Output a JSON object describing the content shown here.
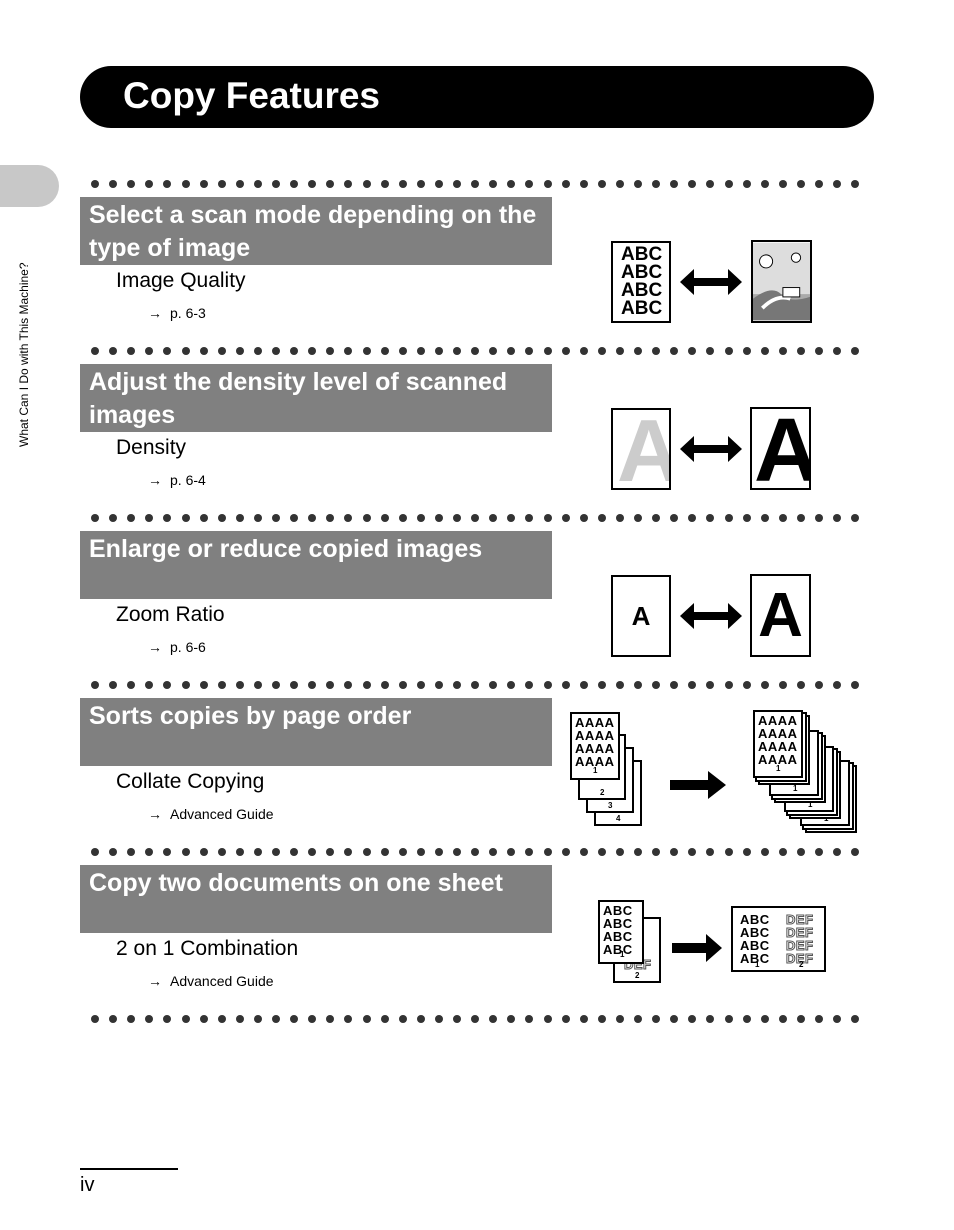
{
  "title": "Copy Features",
  "side_label": "What Can I Do with This Machine?",
  "page_number": "iv",
  "ref_arrow": "→",
  "sections": [
    {
      "heading": "Select a scan mode depending on the type of image",
      "feature": "Image Quality",
      "ref": "p. 6-3"
    },
    {
      "heading": "Adjust the density level of scanned images",
      "feature": "Density",
      "ref": "p. 6-4"
    },
    {
      "heading": "Enlarge or reduce copied images",
      "feature": "Zoom Ratio",
      "ref": "p. 6-6"
    },
    {
      "heading": "Sorts copies by page order",
      "feature": "Collate Copying",
      "ref": "Advanced Guide"
    },
    {
      "heading": "Copy two documents on one sheet",
      "feature": "2 on 1 Combination",
      "ref": "Advanced Guide"
    }
  ],
  "illustrations": {
    "abc": "ABC",
    "letter": "A",
    "aaaa": "AAAA",
    "def": "DEF",
    "n1": "1",
    "n2": "2",
    "n3": "3",
    "n4": "4"
  }
}
